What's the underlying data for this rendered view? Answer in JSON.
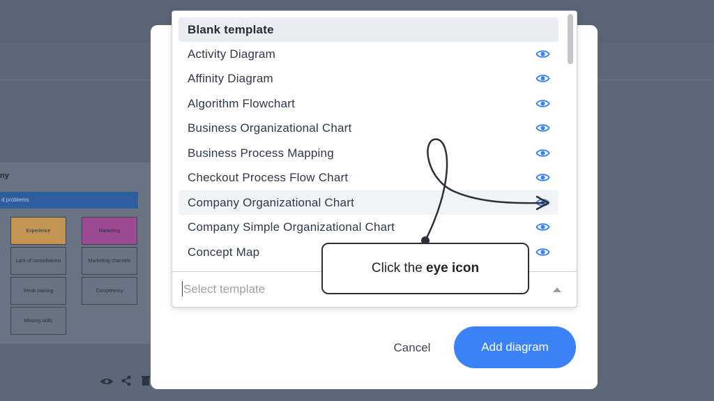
{
  "background": {
    "section_title": "ny",
    "bar_text": "d problems",
    "boxes": [
      {
        "text": "Experience",
        "color": "#c49452"
      },
      {
        "text": "Marketing",
        "color": "#9b4a93"
      },
      {
        "text": "Lack of consultations"
      },
      {
        "text": "Marketing channels"
      },
      {
        "text": "Weak training"
      },
      {
        "text": "Competency"
      },
      {
        "text": "Missing skills"
      }
    ]
  },
  "dropdown": {
    "items": [
      {
        "label": "Blank template"
      },
      {
        "label": "Activity Diagram",
        "has_preview": true
      },
      {
        "label": "Affinity Diagram",
        "has_preview": true
      },
      {
        "label": "Algorithm Flowchart",
        "has_preview": true
      },
      {
        "label": "Business Organizational Chart",
        "has_preview": true
      },
      {
        "label": "Business Process Mapping",
        "has_preview": true
      },
      {
        "label": "Checkout Process Flow Chart",
        "has_preview": true
      },
      {
        "label": "Company Organizational Chart",
        "has_preview": true
      },
      {
        "label": "Company Simple Organizational Chart",
        "has_preview": true
      },
      {
        "label": "Concept Map",
        "has_preview": true
      }
    ],
    "selected_index": 0,
    "hovered_index": 7,
    "placeholder": "Select template",
    "value": ""
  },
  "buttons": {
    "cancel": "Cancel",
    "add": "Add diagram"
  },
  "callout": {
    "prefix": "Click the ",
    "emphasis": "eye icon"
  },
  "colors": {
    "accent": "#3b82f6",
    "eye_icon": "#3b82f6",
    "overlay": "#5e6777"
  }
}
